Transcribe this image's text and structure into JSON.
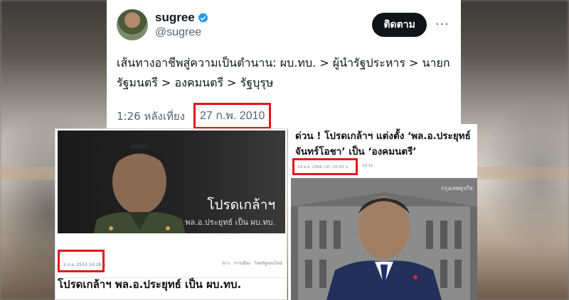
{
  "tweet": {
    "display_name": "sugree",
    "handle": "@sugree",
    "follow_label": "ติดตาม",
    "more_label": "···",
    "text": "เส้นทางอาชีพสู่ความเป็นตำนาน: ผบ.ทบ. > ผู้นำรัฐประหาร > นายกรัฐมนตรี > องคมนตรี > รัฐบุรุษ",
    "time": "1:26 หลังเที่ยง",
    "date": "27 ก.พ. 2010",
    "verified_color": "#1d9bf0"
  },
  "news_left": {
    "caption_main": "โปรดเกล้าฯ",
    "caption_sub": "พล.อ.ประยุทธ์ เป็น ผบ.ทบ.",
    "date": "2 ก.ย. 2553 14:28 น.",
    "tags": [
      "ข่าว",
      "การเมือง",
      "ไทยรัฐออนไลน์"
    ],
    "headline": "โปรดเกล้าฯ พล.อ.ประยุทธ์ เป็น ผบ.ทบ."
  },
  "news_right": {
    "headline": "ด่วน ! โปรดเกล้าฯ แต่งตั้ง ‘พล.อ.ประยุทธ์ จันทร์โอชา’ เป็น ‘องคมนตรี’",
    "date": "29 พ.ย. 2566 เวลา 20:43 น.",
    "views": "18.1k",
    "brand": "กรุงเทพธุรกิจ"
  },
  "highlight_color": "#e8141c"
}
